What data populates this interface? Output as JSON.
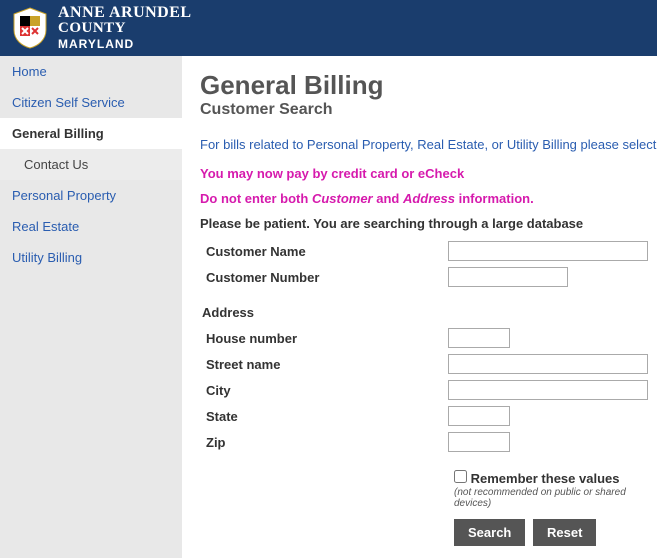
{
  "header": {
    "line1": "ANNE ARUNDEL",
    "line2": "COUNTY",
    "line3": "MARYLAND"
  },
  "sidebar": {
    "items": [
      {
        "label": "Home",
        "active": false,
        "indent": false
      },
      {
        "label": "Citizen Self Service",
        "active": false,
        "indent": false
      },
      {
        "label": "General Billing",
        "active": true,
        "indent": false
      },
      {
        "label": "Contact Us",
        "active": false,
        "indent": true
      },
      {
        "label": "Personal Property",
        "active": false,
        "indent": false
      },
      {
        "label": "Real Estate",
        "active": false,
        "indent": false
      },
      {
        "label": "Utility Billing",
        "active": false,
        "indent": false
      }
    ]
  },
  "main": {
    "title": "General Billing",
    "subtitle": "Customer Search",
    "info_line": "For bills related to Personal Property, Real Estate, or Utility Billing please select the appropriate tab t",
    "warn1": "You may now pay by credit card or eCheck",
    "warn2_a": "Do not enter both ",
    "warn2_b": "Customer",
    "warn2_c": " and ",
    "warn2_d": "Address",
    "warn2_e": " information.",
    "patient": "Please be patient. You are searching through a large database",
    "fields": {
      "customer_name": "Customer Name",
      "customer_number": "Customer Number",
      "address_header": "Address",
      "house_number": "House number",
      "street_name": "Street name",
      "city": "City",
      "state": "State",
      "zip": "Zip"
    },
    "remember": {
      "label": "Remember these values",
      "hint": "(not recommended on public or shared devices)"
    },
    "buttons": {
      "search": "Search",
      "reset": "Reset"
    }
  }
}
